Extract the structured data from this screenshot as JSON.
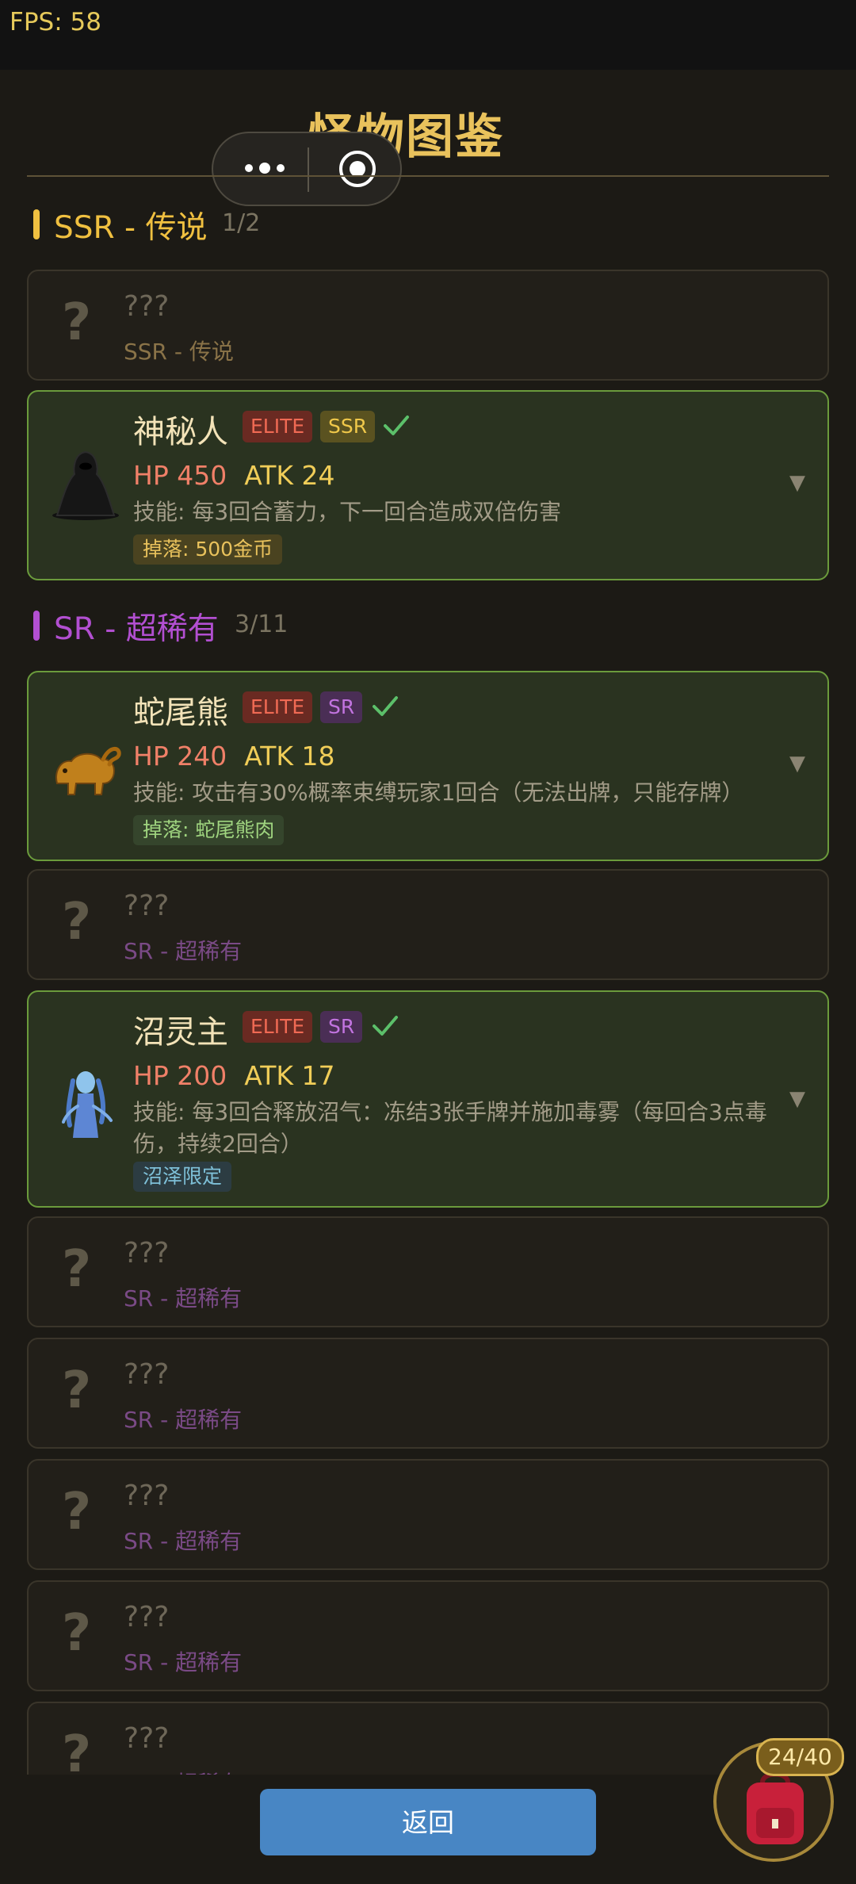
{
  "status": {
    "fps": "FPS: 58"
  },
  "header": {
    "title": "怪物图鉴"
  },
  "sections": {
    "ssr": {
      "name": "SSR - 传说",
      "count": "1/2",
      "color": "#f0c040"
    },
    "sr": {
      "name": "SR - 超稀有",
      "count": "3/11",
      "color": "#b24fd1"
    }
  },
  "cards": {
    "ssr_locked": {
      "name": "???",
      "rarity": "SSR - 传说"
    },
    "mystery_man": {
      "name": "神秘人",
      "elite": "ELITE",
      "rarity": "SSR",
      "hp": "HP 450",
      "atk": "ATK 24",
      "skill": "技能: 每3回合蓄力，下一回合造成双倍伤害",
      "tag": "掉落: 500金币"
    },
    "snake_bear": {
      "name": "蛇尾熊",
      "elite": "ELITE",
      "rarity": "SR",
      "hp": "HP 240",
      "atk": "ATK 18",
      "skill": "技能: 攻击有30%概率束缚玩家1回合（无法出牌，只能存牌）",
      "tag": "掉落: 蛇尾熊肉"
    },
    "sr_locked": {
      "name": "???",
      "rarity": "SR - 超稀有"
    },
    "swamp_lord": {
      "name": "沼灵主",
      "elite": "ELITE",
      "rarity": "SR",
      "hp": "HP 200",
      "atk": "ATK 17",
      "skill": "技能: 每3回合释放沼气：冻结3张手牌并施加毒雾（每回合3点毒伤，持续2回合）",
      "tag": "沼泽限定"
    }
  },
  "footer": {
    "back_label": "返回",
    "bag_count": "24/40"
  }
}
